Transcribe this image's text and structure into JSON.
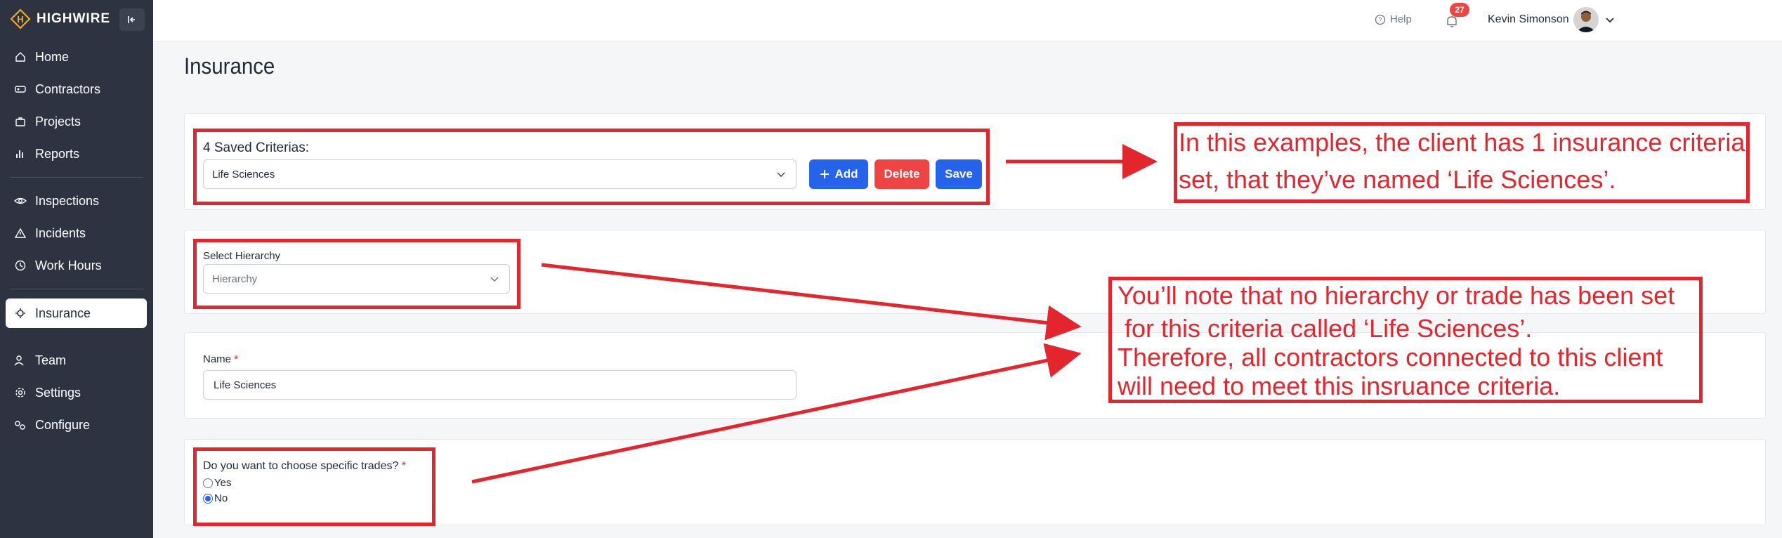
{
  "app": {
    "logo_text": "HIGHWIRE"
  },
  "sidebar": {
    "items": [
      {
        "label": "Home",
        "icon": "home-icon"
      },
      {
        "label": "Contractors",
        "icon": "contractors-icon"
      },
      {
        "label": "Projects",
        "icon": "briefcase-icon"
      },
      {
        "label": "Reports",
        "icon": "bar-chart-icon"
      },
      {
        "label": "Inspections",
        "icon": "eye-icon"
      },
      {
        "label": "Incidents",
        "icon": "warning-icon"
      },
      {
        "label": "Work Hours",
        "icon": "clock-icon"
      },
      {
        "label": "Insurance",
        "icon": "gear-sun-icon",
        "active": true
      },
      {
        "label": "Team",
        "icon": "team-icon"
      },
      {
        "label": "Settings",
        "icon": "settings-icon"
      },
      {
        "label": "Configure",
        "icon": "configure-icon"
      }
    ]
  },
  "topbar": {
    "help_label": "Help",
    "notification_count": "27",
    "user_name": "Kevin Simonson"
  },
  "page": {
    "title": "Insurance"
  },
  "criteria": {
    "saved_label": "4 Saved Criterias:",
    "selected_value": "Life Sciences",
    "add_label": "Add",
    "delete_label": "Delete",
    "save_label": "Save"
  },
  "hierarchy": {
    "label": "Select Hierarchy",
    "placeholder": "Hierarchy"
  },
  "name_field": {
    "label": "Name",
    "required_mark": "*",
    "value": "Life Sciences"
  },
  "trades": {
    "question": "Do you want to choose specific trades?",
    "required_mark": "*",
    "option_yes": "Yes",
    "option_no": "No",
    "selected": "No"
  },
  "annotations": {
    "note1_line1": "In this examples, the client has 1 insurance criteria",
    "note1_line2": "set, that they’ve named ‘Life Sciences’.",
    "note2_line1": "You’ll note that no hierarchy or trade has been set",
    "note2_line2": " for this criteria called ‘Life Sciences’.",
    "note2_line3": "Therefore, all contractors connected to this client",
    "note2_line4": "will need to meet this insruance criteria.",
    "color": "#e3262d"
  },
  "colors": {
    "sidebar_bg": "#2d3340",
    "primary": "#2563eb",
    "danger": "#ef4444",
    "logo_accent": "#f5a623"
  }
}
